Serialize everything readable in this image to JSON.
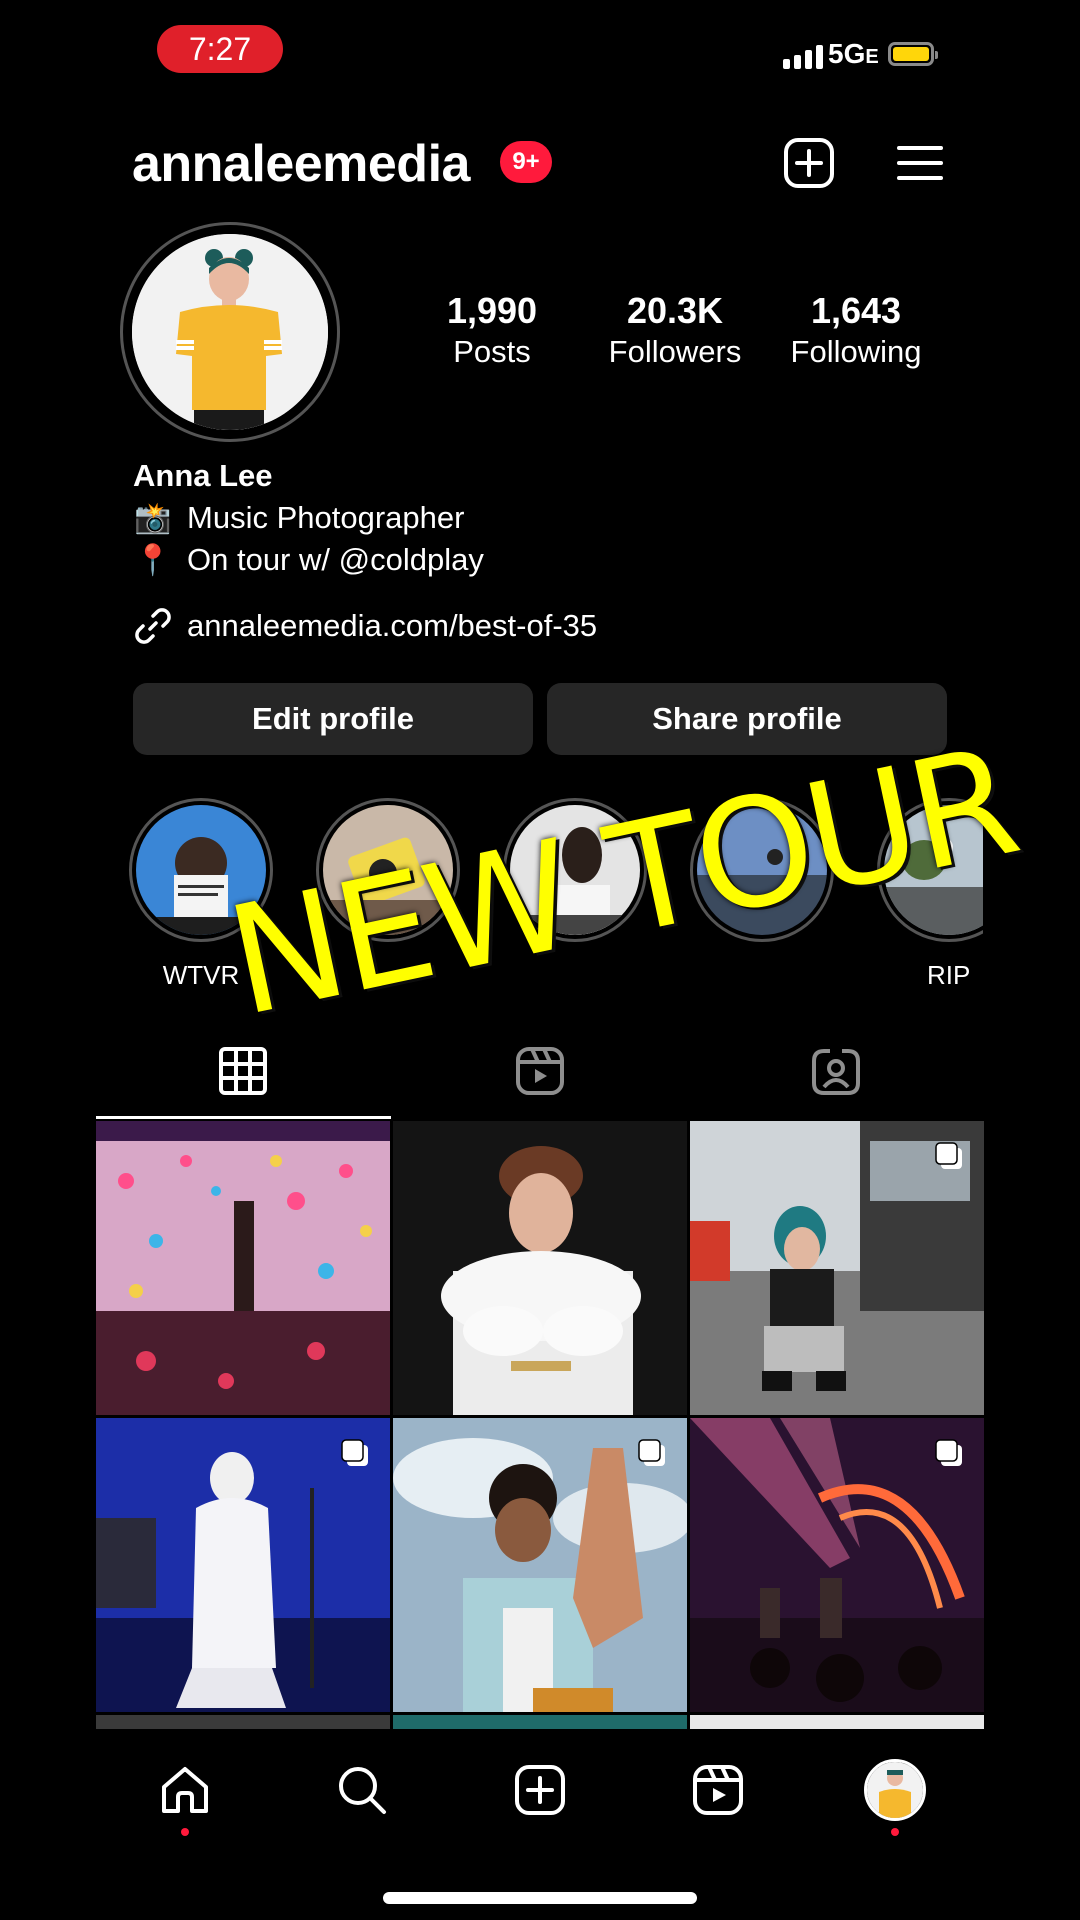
{
  "status": {
    "time": "7:27",
    "network": "5G",
    "network_suffix": "E"
  },
  "header": {
    "username": "annaleemedia",
    "notification_badge": "9+"
  },
  "profile": {
    "stats": [
      {
        "value": "1,990",
        "label": "Posts"
      },
      {
        "value": "20.3K",
        "label": "Followers"
      },
      {
        "value": "1,643",
        "label": "Following"
      }
    ],
    "name": "Anna Lee",
    "bio_lines": [
      {
        "emoji": "📸",
        "text": "Music Photographer"
      },
      {
        "emoji": "📍",
        "text": "On tour w/ @coldplay"
      }
    ],
    "link": "annaleemedia.com/best-of-35"
  },
  "buttons": {
    "edit": "Edit profile",
    "share": "Share profile"
  },
  "highlights": [
    {
      "label": "WTVR"
    },
    {
      "label": ""
    },
    {
      "label": ""
    },
    {
      "label": ""
    },
    {
      "label": "RIP"
    }
  ],
  "overlay": {
    "text": "NEW TOUR",
    "color": "#ffff00"
  },
  "colors": {
    "accent": "#ff1a3c",
    "time_pill": "#e0202a",
    "button_bg": "#262626"
  }
}
